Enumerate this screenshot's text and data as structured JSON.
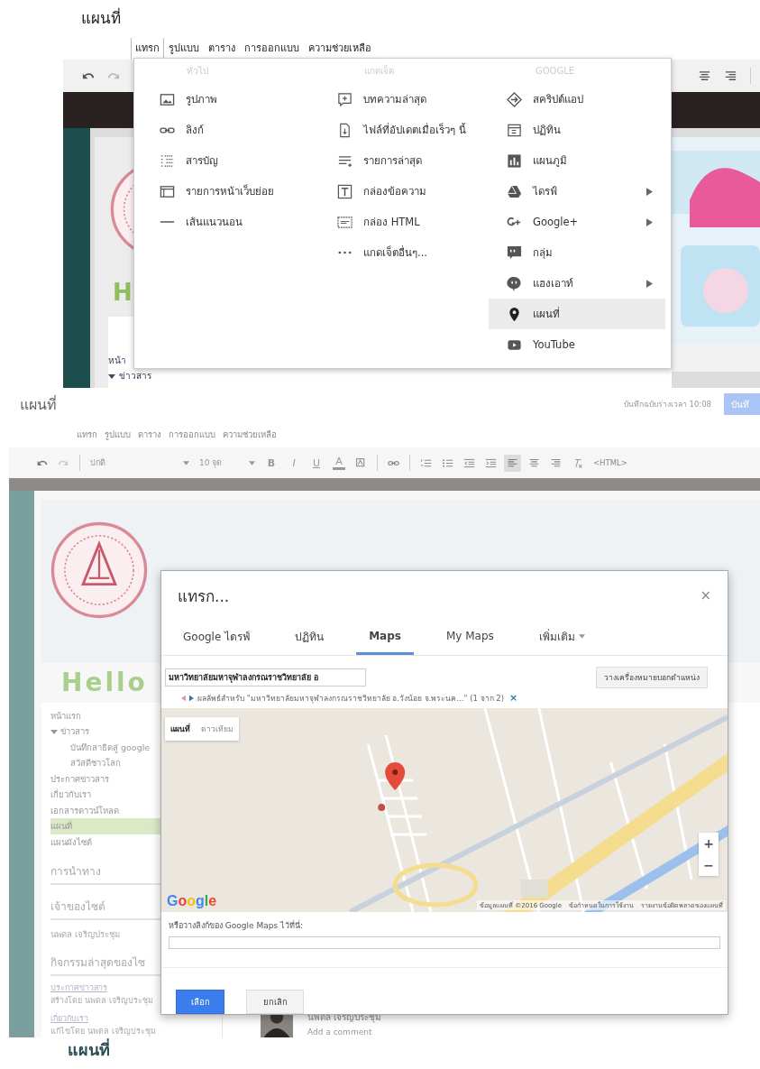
{
  "page_heading": "แผนที่",
  "shot1": {
    "menu": [
      {
        "label": "แทรก",
        "selected": true
      },
      {
        "label": "รูปแบบ",
        "selected": false
      },
      {
        "label": "ตาราง",
        "selected": false
      },
      {
        "label": "การออกแบบ",
        "selected": false
      },
      {
        "label": "ความช่วยเหลือ",
        "selected": false
      }
    ],
    "dropdown": {
      "columns": [
        {
          "header": "ทั่วไป",
          "items": [
            {
              "label": "รูปภาพ",
              "submenu": false,
              "selected": false
            },
            {
              "label": "ลิงก์",
              "submenu": false,
              "selected": false
            },
            {
              "label": "สารบัญ",
              "submenu": false,
              "selected": false
            },
            {
              "label": "รายการหน้าเว็บย่อย",
              "submenu": false,
              "selected": false
            },
            {
              "label": "เส้นแนวนอน",
              "submenu": false,
              "selected": false
            }
          ]
        },
        {
          "header": "แกดเจ็ต",
          "items": [
            {
              "label": "บทความล่าสุด",
              "submenu": false,
              "selected": false
            },
            {
              "label": "ไฟล์ที่อัปเดตเมื่อเร็วๆ นี้",
              "submenu": false,
              "selected": false
            },
            {
              "label": "รายการล่าสุด",
              "submenu": false,
              "selected": false
            },
            {
              "label": "กล่องข้อความ",
              "submenu": false,
              "selected": false
            },
            {
              "label": "กล่อง HTML",
              "submenu": false,
              "selected": false
            },
            {
              "label": "แกดเจ็ตอื่นๆ...",
              "submenu": false,
              "selected": false
            }
          ]
        },
        {
          "header": "GOOGLE",
          "items": [
            {
              "label": "สคริปต์แอป",
              "submenu": false,
              "selected": false
            },
            {
              "label": "ปฏิทิน",
              "submenu": false,
              "selected": false
            },
            {
              "label": "แผนภูมิ",
              "submenu": false,
              "selected": false
            },
            {
              "label": "ไดรฟ์",
              "submenu": true,
              "selected": false
            },
            {
              "label": "Google+",
              "submenu": true,
              "selected": false
            },
            {
              "label": "กลุ่ม",
              "submenu": false,
              "selected": false
            },
            {
              "label": "แฮงเอาท์",
              "submenu": true,
              "selected": false
            },
            {
              "label": "แผนที่",
              "submenu": false,
              "selected": true
            },
            {
              "label": "YouTube",
              "submenu": false,
              "selected": false
            }
          ]
        }
      ]
    },
    "site_title_fragment": "H",
    "sidebar": [
      {
        "label": "หน้า"
      },
      {
        "label": "ข่าวสาร",
        "expanded": true
      }
    ]
  },
  "editor": {
    "title": "แผนที่",
    "save_status": "บันทึกฉบับร่างเวลา 10:08",
    "save_button": "บันทึ",
    "menu": [
      "แทรก",
      "รูปแบบ",
      "ตาราง",
      "การออกแบบ",
      "ความช่วยเหลือ"
    ],
    "toolbar": {
      "font": "ปกติ",
      "size": "10 จุด",
      "format_buttons": [
        "B",
        "I",
        "U",
        "A"
      ],
      "html": "<HTML>"
    }
  },
  "site": {
    "title_fragment": "Hello",
    "sidebar": [
      {
        "label": "หน้าแรก",
        "selected": false
      },
      {
        "label": "ข่าวสาร",
        "selected": false,
        "expanded": true,
        "children": [
          {
            "label": "บันทึกสาธิตสู่ google",
            "selected": false
          },
          {
            "label": "สวัสดีชาวโลก",
            "selected": false
          }
        ]
      },
      {
        "label": "ประกาศข่าวสาร",
        "selected": false
      },
      {
        "label": "เกี่ยวกับเรา",
        "selected": false
      },
      {
        "label": "เอกสารดาวน์โหลด",
        "selected": false
      },
      {
        "label": "แผนที่",
        "selected": true
      },
      {
        "label": "แผนผังไซต์",
        "selected": false
      }
    ],
    "nav_heading": "การนำทาง",
    "owner_heading": "เจ้าของไซต์",
    "owner": "นพดล เจริญประชุม",
    "activity_heading": "กิจกรรมล่าสุดของไซ",
    "activity": [
      {
        "link": "ประกาศข่าวสาร",
        "note": "สร้างโดย นพดล เจริญประชุม"
      },
      {
        "link": "เกี่ยวกับเรา",
        "note": "แก้ไขโดย นพดล เจริญประชุม"
      }
    ],
    "comment_author": "นพดล เจริญประชุม",
    "comment_placeholder": "Add a comment"
  },
  "dialog": {
    "title": "แทรก...",
    "close": "×",
    "tabs": [
      {
        "label": "Google ไดรฟ์",
        "selected": false,
        "dropdown": false
      },
      {
        "label": "ปฏิทิน",
        "selected": false,
        "dropdown": false
      },
      {
        "label": "Maps",
        "selected": true,
        "dropdown": false
      },
      {
        "label": "My Maps",
        "selected": false,
        "dropdown": false
      },
      {
        "label": "เพิ่มเติม",
        "selected": false,
        "dropdown": true
      }
    ],
    "search_value": "มหาวิทยาลัยมหาจุฬาลงกรณราชวิทยาลัย อ",
    "marker_button": "วางเครื่องหมายบอกตำแหน่ง",
    "result": "ผลลัพธ์สำหรับ \"มหาวิทยาลัยมหาจุฬาลงกรณราชวิทยาลัย อ.วังน้อย จ.พระนค...\" (1 จาก 2)",
    "clear": "×",
    "map": {
      "types": [
        {
          "label": "แผนที่",
          "selected": true
        },
        {
          "label": "ดาวเทียม",
          "selected": false
        }
      ],
      "zoom_in": "+",
      "zoom_out": "−",
      "logo": "Google",
      "attribution": [
        "ข้อมูลแผนที่ ©2016 Google",
        "ข้อกำหนดในการใช้งาน",
        "รายงานข้อผิดพลาดของแผนที่"
      ]
    },
    "link_label": "หรือวางลิงก์ของ Google Maps ไว้ที่นี่:",
    "select_button": "เลือก",
    "cancel_button": "ยกเลิก"
  },
  "bottom_heading": "แผนที่"
}
